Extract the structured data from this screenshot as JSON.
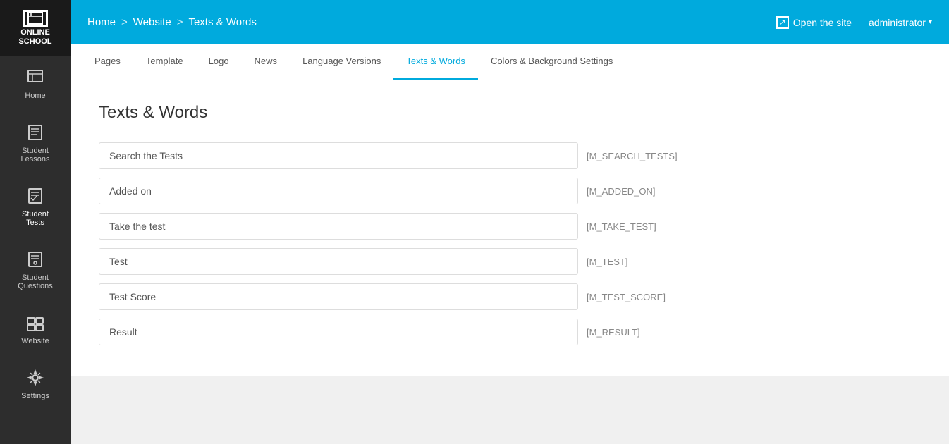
{
  "brand": {
    "line1": "ONLINE",
    "line2": "SCHOOL"
  },
  "sidebar": {
    "items": [
      {
        "id": "home",
        "label": "Home",
        "icon": "home-icon"
      },
      {
        "id": "student-lessons",
        "label": "Student Lessons",
        "icon": "lessons-icon"
      },
      {
        "id": "student-tests",
        "label": "Student Tests",
        "icon": "tests-icon"
      },
      {
        "id": "student-questions",
        "label": "Student Questions",
        "icon": "questions-icon"
      },
      {
        "id": "website",
        "label": "Website",
        "icon": "website-icon"
      },
      {
        "id": "settings",
        "label": "Settings",
        "icon": "settings-icon"
      }
    ]
  },
  "topnav": {
    "breadcrumb": [
      {
        "label": "Home",
        "active": false
      },
      {
        "label": "Website",
        "active": false
      },
      {
        "label": "Texts & Words",
        "active": true
      }
    ],
    "open_site_label": "Open the site",
    "admin_label": "administrator"
  },
  "tabs": [
    {
      "id": "pages",
      "label": "Pages",
      "active": false
    },
    {
      "id": "template",
      "label": "Template",
      "active": false
    },
    {
      "id": "logo",
      "label": "Logo",
      "active": false
    },
    {
      "id": "news",
      "label": "News",
      "active": false
    },
    {
      "id": "language-versions",
      "label": "Language Versions",
      "active": false
    },
    {
      "id": "texts-words",
      "label": "Texts & Words",
      "active": true
    },
    {
      "id": "colors-background",
      "label": "Colors & Background Settings",
      "active": false
    }
  ],
  "page": {
    "title": "Texts & Words",
    "fields": [
      {
        "id": "search-tests",
        "value": "Search the Tests",
        "token": "[M_SEARCH_TESTS]"
      },
      {
        "id": "added-on",
        "value": "Added on",
        "token": "[M_ADDED_ON]"
      },
      {
        "id": "take-test",
        "value": "Take the test",
        "token": "[M_TAKE_TEST]"
      },
      {
        "id": "test",
        "value": "Test",
        "token": "[M_TEST]"
      },
      {
        "id": "test-score",
        "value": "Test Score",
        "token": "[M_TEST_SCORE]"
      },
      {
        "id": "result",
        "value": "Result",
        "token": "[M_RESULT]"
      }
    ]
  },
  "colors": {
    "topnav_bg": "#00aadd",
    "tab_active_color": "#00aadd",
    "sidebar_bg": "#2d2d2d"
  }
}
